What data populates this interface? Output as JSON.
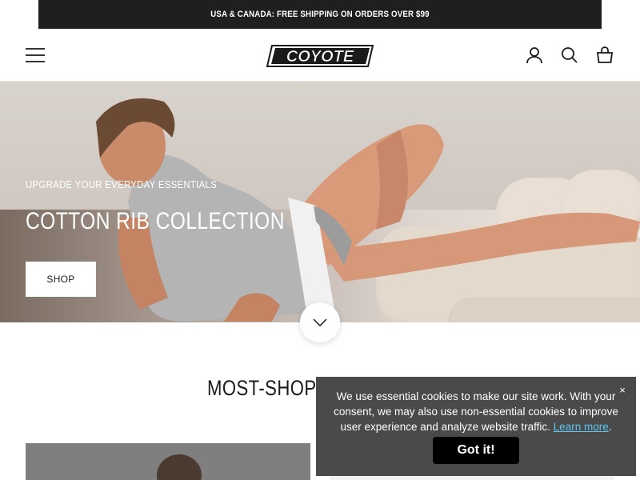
{
  "announcement": {
    "text": "USA & CANADA: FREE SHIPPING ON ORDERS OVER $99"
  },
  "header": {
    "logo_text": "COYOTE",
    "icons": [
      "menu-icon",
      "account-icon",
      "search-icon",
      "cart-icon"
    ]
  },
  "hero": {
    "subtitle": "UPGRADE YOUR EVERYDAY ESSENTIALS",
    "title": "COTTON RIB COLLECTION",
    "cta_label": "SHOP"
  },
  "section": {
    "title": "MOST-SHOPPE"
  },
  "cookie": {
    "message": "We use essential cookies to make our site work. With your consent, we may also use non-essential cookies to improve user experience and analyze website traffic.",
    "link_label": "Learn more",
    "button_label": "Got it!",
    "close_label": "×"
  },
  "colors": {
    "announcement_bg": "#1f1f1f",
    "cookie_bg": "#4a4a4a",
    "link": "#5fc7f0"
  }
}
